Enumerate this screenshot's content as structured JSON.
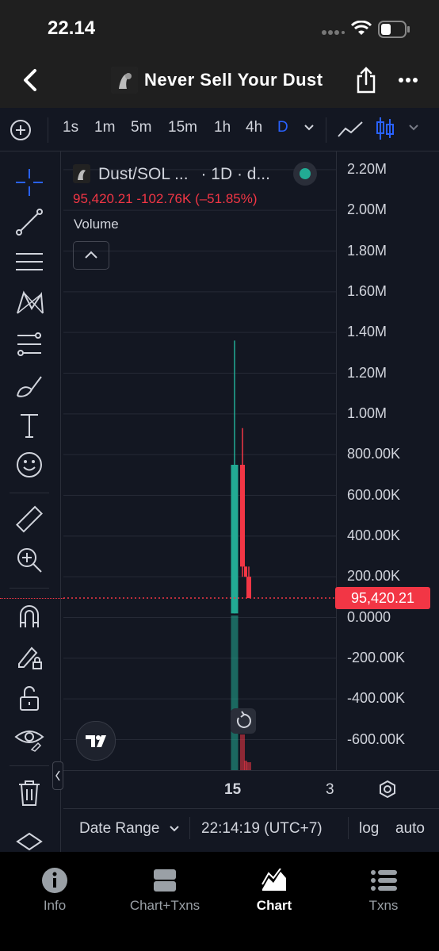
{
  "status_bar": {
    "time": "22.14"
  },
  "nav": {
    "title": "Never Sell Your Dust"
  },
  "toolbar": {
    "timeframes": [
      "1s",
      "1m",
      "5m",
      "15m",
      "1h",
      "4h",
      "D"
    ],
    "active_timeframe": "D"
  },
  "legend": {
    "symbol": "Dust/SOL ...",
    "interval": "· 1D · d...",
    "values": "95,420.21  -102.76K (–51.85%)",
    "indicator": "Volume"
  },
  "price_axis": {
    "labels": [
      "2.20M",
      "2.00M",
      "1.80M",
      "1.60M",
      "1.40M",
      "1.20M",
      "1.00M",
      "800.00K",
      "600.00K",
      "400.00K",
      "200.00K",
      "0.0000",
      "-200.00K",
      "-400.00K",
      "-600.00K"
    ],
    "current_price": "95,420.21"
  },
  "time_axis": {
    "labels": [
      "15",
      "3"
    ]
  },
  "bottom_bar": {
    "date_range": "Date Range",
    "clock": "22:14:19 (UTC+7)",
    "log": "log",
    "auto": "auto"
  },
  "tabs": [
    {
      "label": "Info",
      "icon": "info-icon"
    },
    {
      "label": "Chart+Txns",
      "icon": "split-view-icon"
    },
    {
      "label": "Chart",
      "icon": "chart-icon",
      "active": true
    },
    {
      "label": "Txns",
      "icon": "list-icon"
    }
  ],
  "colors": {
    "up": "#22ab94",
    "down": "#f23645",
    "accent": "#2962ff",
    "background": "#131722"
  },
  "chart_data": {
    "type": "candlestick",
    "candles": [
      {
        "x": "15",
        "open": 20000,
        "high": 1360000,
        "low": 20000,
        "close": 750000
      },
      {
        "x": "16",
        "open": 750000,
        "high": 930000,
        "low": 200000,
        "close": 250000
      },
      {
        "x": "17",
        "open": 250000,
        "high": 250000,
        "low": 200000,
        "close": 200000
      },
      {
        "x": "18",
        "open": 200000,
        "high": 250000,
        "low": 95000,
        "close": 95420.21
      }
    ],
    "volume": [
      {
        "x": "15",
        "direction": "up"
      },
      {
        "x": "16",
        "direction": "down"
      },
      {
        "x": "17",
        "direction": "down"
      },
      {
        "x": "18",
        "direction": "down"
      }
    ],
    "ylim": [
      -750000,
      2250000
    ]
  }
}
